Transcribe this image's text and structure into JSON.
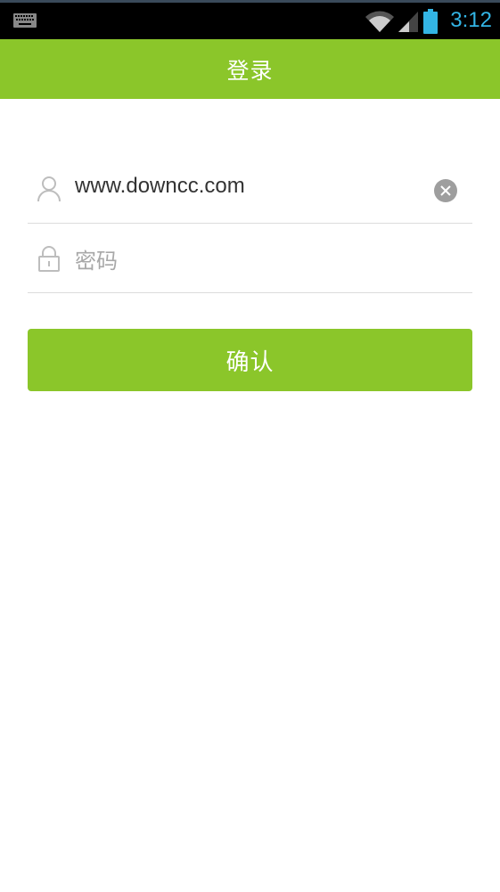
{
  "status_bar": {
    "time": "3:12",
    "icons": [
      "keyboard-icon",
      "wifi-icon",
      "cell-signal-icon",
      "battery-icon"
    ],
    "time_color": "#33b5e5"
  },
  "header": {
    "title": "登录",
    "color": "#8bc62a"
  },
  "form": {
    "username": {
      "value": "www.downcc.com",
      "icon": "user-icon",
      "clear_icon": "clear-icon"
    },
    "password": {
      "placeholder": "密码",
      "icon": "lock-icon"
    }
  },
  "confirm_button": {
    "label": "确认",
    "color": "#8bc62a"
  }
}
